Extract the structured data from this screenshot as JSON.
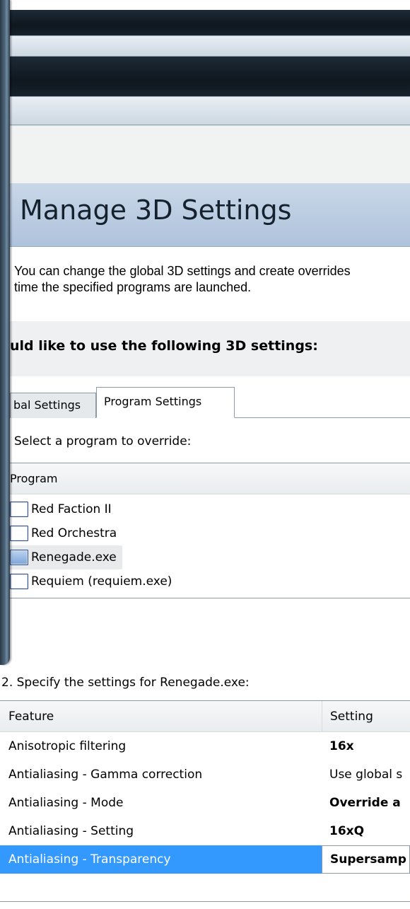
{
  "page": {
    "title": "Manage 3D Settings",
    "description_line1": "You can change the global 3D settings and create overrides",
    "description_line2": "time the specified programs are launched.",
    "section_heading": "uld like to use the following 3D settings:"
  },
  "tabs": [
    {
      "label": "bal Settings",
      "active": false
    },
    {
      "label": "Program Settings",
      "active": true
    }
  ],
  "program_select": {
    "prompt": "Select a program to override:",
    "column_header": "Program",
    "items": [
      {
        "label": "Red Faction II",
        "selected": false
      },
      {
        "label": "Red Orchestra",
        "selected": false
      },
      {
        "label": "Renegade.exe",
        "selected": true
      },
      {
        "label": "Requiem (requiem.exe)",
        "selected": false
      }
    ]
  },
  "settings": {
    "step_label": "2. Specify the settings for Renegade.exe:",
    "header_feature": "Feature",
    "header_setting": "Setting",
    "rows": [
      {
        "feature": "Anisotropic filtering",
        "setting": "16x",
        "bold": true,
        "selected": false
      },
      {
        "feature": "Antialiasing - Gamma correction",
        "setting": "Use global s",
        "bold": false,
        "selected": false
      },
      {
        "feature": "Antialiasing - Mode",
        "setting": "Override a",
        "bold": true,
        "selected": false
      },
      {
        "feature": "Antialiasing - Setting",
        "setting": "16xQ",
        "bold": true,
        "selected": false
      },
      {
        "feature": "Antialiasing - Transparency",
        "setting": "Supersamp",
        "bold": true,
        "selected": true
      }
    ]
  },
  "colors": {
    "selection": "#3399ff",
    "banner": "#aec3dc"
  }
}
